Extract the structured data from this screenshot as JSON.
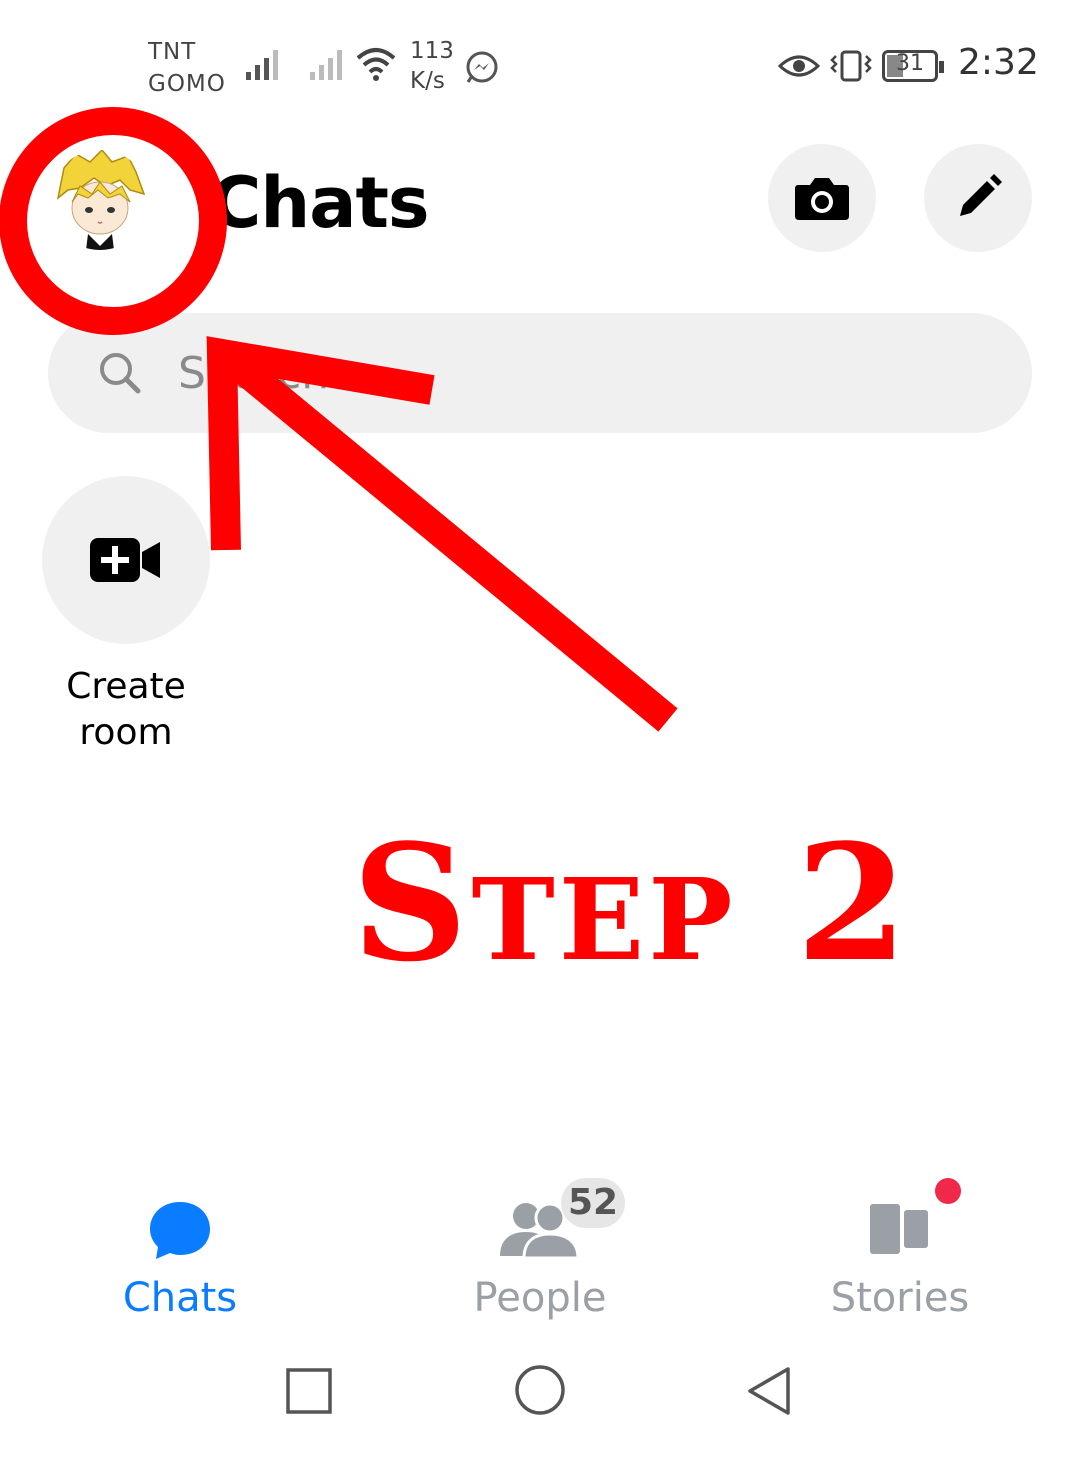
{
  "status_bar": {
    "carrier_line1": "TNT",
    "carrier_line2": "GOMO",
    "speed_value": "113",
    "speed_unit": "K/s",
    "battery": "31",
    "time": "2:32"
  },
  "header": {
    "title": "Chats"
  },
  "search": {
    "placeholder": "Search"
  },
  "create_room": {
    "label_line1": "Create",
    "label_line2": "room"
  },
  "annotation": {
    "step_text": "Step 2",
    "color": "#ff0000"
  },
  "bottom_nav": {
    "items": [
      {
        "label": "Chats",
        "active": true,
        "color": "#0a7cff"
      },
      {
        "label": "People",
        "active": false,
        "badge": "52",
        "color": "#9aa0a6"
      },
      {
        "label": "Stories",
        "active": false,
        "color": "#9aa0a6"
      }
    ]
  },
  "colors": {
    "accent": "#0a7cff",
    "inactive": "#9aa0a6",
    "button_bg": "#f0f0f0",
    "notification_dot": "#f02849"
  }
}
